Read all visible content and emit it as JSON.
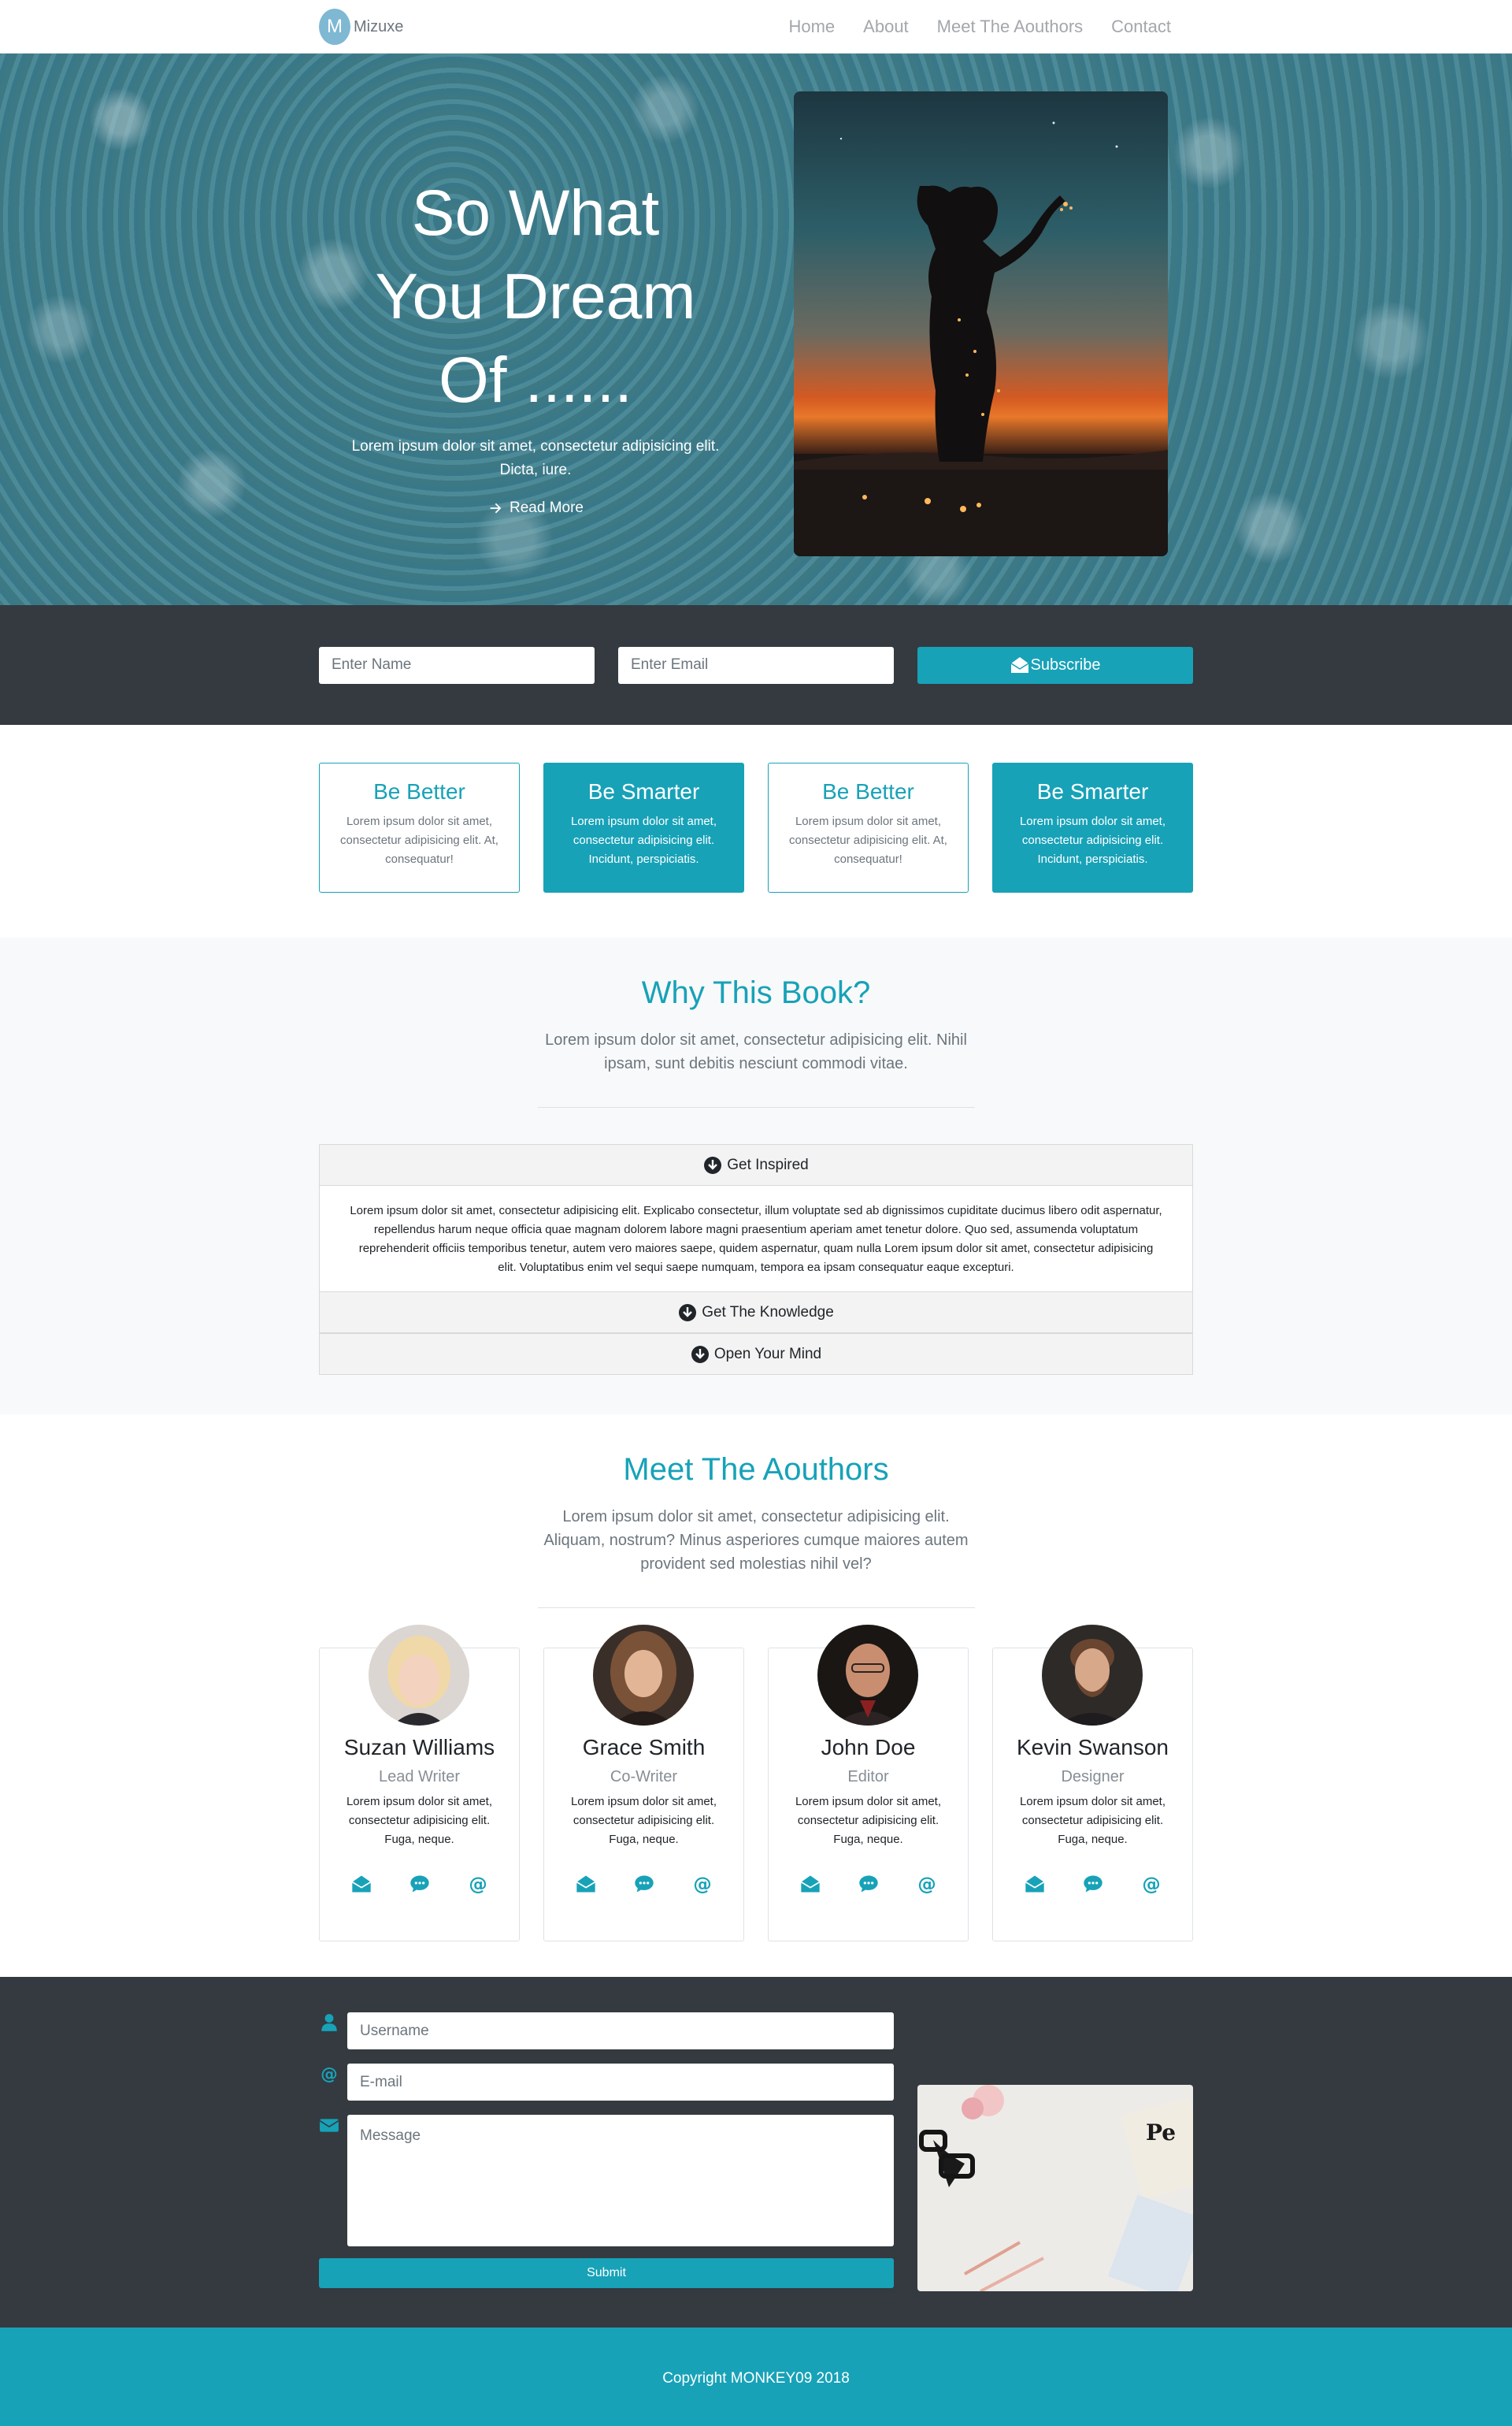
{
  "nav": {
    "brand_initial": "M",
    "brand_name": "Mizuxe",
    "links": [
      "Home",
      "About",
      "Meet The Aouthors",
      "Contact"
    ]
  },
  "hero": {
    "title": "So What You Dream Of ......",
    "subtitle": "Lorem ipsum dolor sit amet, consectetur adipisicing elit. Dicta, iure.",
    "cta": "Read More"
  },
  "subscribe": {
    "name_placeholder": "Enter Name",
    "email_placeholder": "Enter Email",
    "button": "Subscribe"
  },
  "features": [
    {
      "title": "Be Better",
      "text": "Lorem ipsum dolor sit amet, consectetur adipisicing elit. At, consequatur!",
      "filled": false
    },
    {
      "title": "Be Smarter",
      "text": "Lorem ipsum dolor sit amet, consectetur adipisicing elit. Incidunt, perspiciatis.",
      "filled": true
    },
    {
      "title": "Be Better",
      "text": "Lorem ipsum dolor sit amet, consectetur adipisicing elit. At, consequatur!",
      "filled": false
    },
    {
      "title": "Be Smarter",
      "text": "Lorem ipsum dolor sit amet, consectetur adipisicing elit. Incidunt, perspiciatis.",
      "filled": true
    }
  ],
  "why": {
    "title": "Why This Book?",
    "lead": "Lorem ipsum dolor sit amet, consectetur adipisicing elit. Nihil ipsam, sunt debitis nesciunt commodi vitae.",
    "accordion": [
      {
        "label": "Get Inspired",
        "body": "Lorem ipsum dolor sit amet, consectetur adipisicing elit. Explicabo consectetur, illum voluptate sed ab dignissimos cupiditate ducimus libero odit aspernatur, repellendus harum neque officia quae magnam dolorem labore magni praesentium aperiam amet tenetur dolore. Quo sed, assumenda voluptatum reprehenderit officiis temporibus tenetur, autem vero maiores saepe, quidem aspernatur, quam nulla Lorem ipsum dolor sit amet, consectetur adipisicing elit. Voluptatibus enim vel sequi saepe numquam, tempora ea ipsam consequatur eaque excepturi."
      },
      {
        "label": "Get The Knowledge"
      },
      {
        "label": "Open Your Mind"
      }
    ]
  },
  "authors": {
    "title": "Meet The Aouthors",
    "lead": "Lorem ipsum dolor sit amet, consectetur adipisicing elit. Aliquam, nostrum? Minus asperiores cumque maiores autem provident sed molestias nihil vel?",
    "people": [
      {
        "name": "Suzan Williams",
        "role": "Lead Writer",
        "bio": "Lorem ipsum dolor sit amet, consectetur adipisicing elit. Fuga, neque."
      },
      {
        "name": "Grace Smith",
        "role": "Co-Writer",
        "bio": "Lorem ipsum dolor sit amet, consectetur adipisicing elit. Fuga, neque."
      },
      {
        "name": "John Doe",
        "role": "Editor",
        "bio": "Lorem ipsum dolor sit amet, consectetur adipisicing elit. Fuga, neque."
      },
      {
        "name": "Kevin Swanson",
        "role": "Designer",
        "bio": "Lorem ipsum dolor sit amet, consectetur adipisicing elit. Fuga, neque."
      }
    ]
  },
  "contact": {
    "username_placeholder": "Username",
    "email_placeholder": "E-mail",
    "message_placeholder": "Message",
    "submit": "Submit"
  },
  "footer": {
    "copyright": "Copyright MONKEY09 2018"
  },
  "colors": {
    "accent": "#17a2b8",
    "dark": "#343a40",
    "light": "#f8f9fa"
  }
}
